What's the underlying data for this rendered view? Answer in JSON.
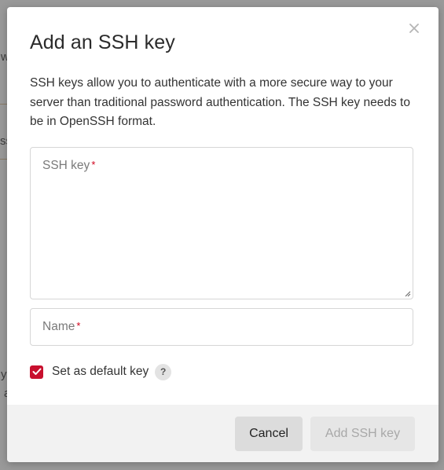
{
  "background": {
    "fragments": [
      "w",
      "ss",
      "y",
      "a"
    ]
  },
  "modal": {
    "title": "Add an SSH key",
    "description": "SSH keys allow you to authenticate with a more secure way to your server than traditional password authentication. The SSH key needs to be in OpenSSH format.",
    "ssh_key_field": {
      "label": "SSH key",
      "required_mark": "*",
      "value": ""
    },
    "name_field": {
      "label": "Name",
      "required_mark": "*",
      "value": ""
    },
    "default_checkbox": {
      "label": "Set as default key",
      "checked": true,
      "help_icon": "question-mark"
    },
    "close_icon": "close-x",
    "buttons": {
      "cancel": "Cancel",
      "submit": "Add SSH key"
    }
  },
  "colors": {
    "accent": "#c8102e",
    "required": "#d0021b",
    "overlay": "#464646"
  }
}
